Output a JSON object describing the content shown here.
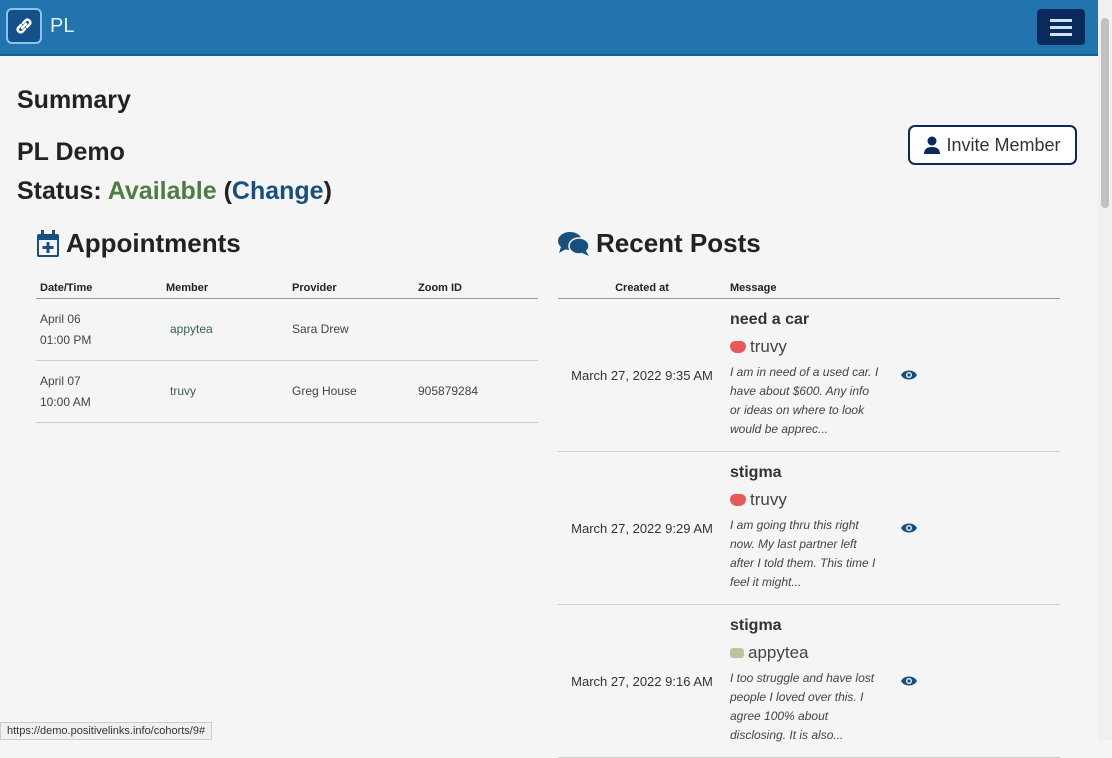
{
  "header": {
    "brand": "PL"
  },
  "page": {
    "title": "Summary",
    "org": "PL Demo",
    "status_label": "Status:",
    "status_value": "Available",
    "change_label": "Change",
    "invite_label": "Invite Member"
  },
  "appointments": {
    "title": "Appointments",
    "columns": [
      "Date/Time",
      "Member",
      "Provider",
      "Zoom ID"
    ],
    "rows": [
      {
        "date": "April 06",
        "time": "01:00 PM",
        "member": "appytea",
        "provider": "Sara Drew",
        "zoom": ""
      },
      {
        "date": "April 07",
        "time": "10:00 AM",
        "member": "truvy",
        "provider": "Greg House",
        "zoom": "905879284"
      }
    ]
  },
  "posts": {
    "title": "Recent Posts",
    "columns": [
      "Created at",
      "Message"
    ],
    "rows": [
      {
        "created": "March 27, 2022 9:35 AM",
        "title": "need a car",
        "user": "truvy",
        "avatar": "heart",
        "message": "I am in need of a used car. I have about $600. Any info or ideas on where to look would be apprec..."
      },
      {
        "created": "March 27, 2022 9:29 AM",
        "title": "stigma",
        "user": "truvy",
        "avatar": "heart",
        "message": "I am going thru this right now. My last partner left after I told them. This time I feel it might..."
      },
      {
        "created": "March 27, 2022 9:16 AM",
        "title": "stigma",
        "user": "appytea",
        "avatar": "cup",
        "message": "I too struggle and have lost people I loved over this. I agree 100% about disclosing. It is also..."
      }
    ]
  },
  "statusbar": {
    "url": "https://demo.positivelinks.info/cohorts/9#"
  }
}
